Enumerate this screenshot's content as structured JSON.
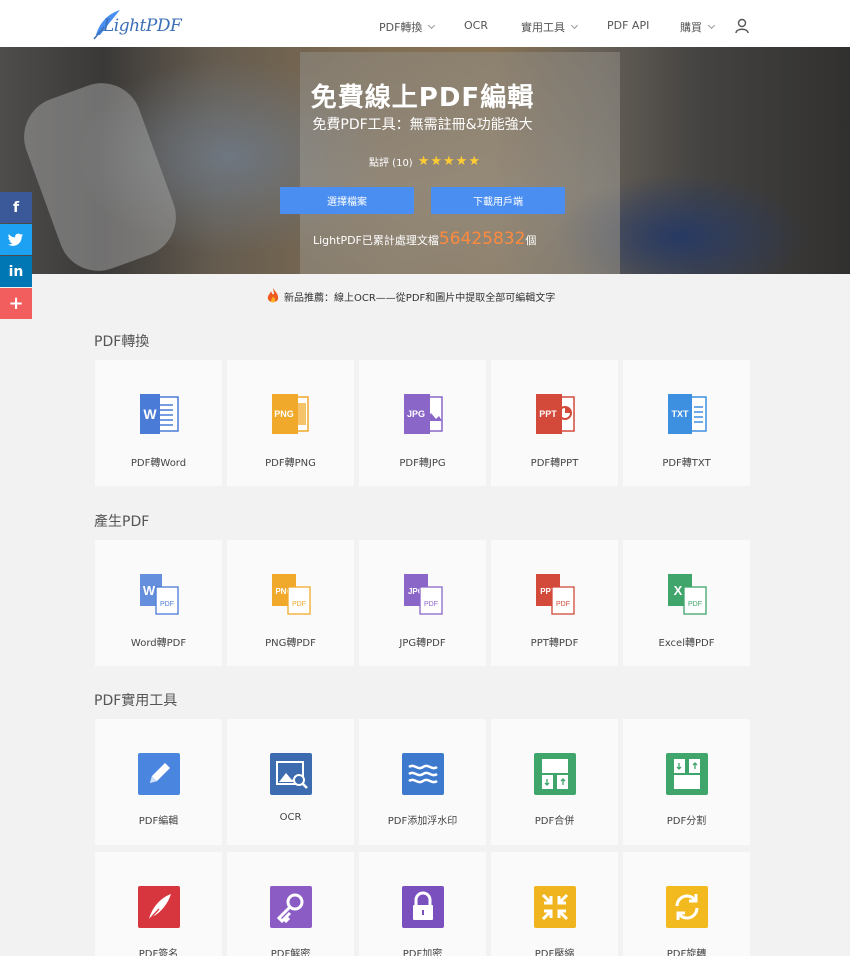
{
  "header": {
    "logo_text": "LightPDF",
    "nav": [
      {
        "label": "PDF轉換",
        "dropdown": true
      },
      {
        "label": "OCR",
        "dropdown": false
      },
      {
        "label": "實用工具",
        "dropdown": true
      },
      {
        "label": "PDF API",
        "dropdown": false
      },
      {
        "label": "購買",
        "dropdown": true
      }
    ]
  },
  "hero": {
    "title": "免費線上PDF編輯",
    "subtitle": "免費PDF工具：無需註冊&功能強大",
    "rating_label": "點評 (10)",
    "stars": "★★★★★",
    "btn_select": "選擇檔案",
    "btn_download": "下載用戶端",
    "count_prefix": "LightPDF已累計處理文檔",
    "count_value": "56425832",
    "count_suffix": "個"
  },
  "social": [
    {
      "name": "facebook",
      "glyph": "f",
      "color": "#3b5998"
    },
    {
      "name": "twitter",
      "glyph": "t",
      "color": "#1da1f2"
    },
    {
      "name": "linkedin",
      "glyph": "in",
      "color": "#0077b5"
    },
    {
      "name": "more",
      "glyph": "+",
      "color": "#f25d5d"
    }
  ],
  "news": "新品推薦：線上OCR——從PDF和圖片中提取全部可編輯文字",
  "sections": {
    "convert_title": "PDF轉換",
    "create_title": "產生PDF",
    "tools_title": "PDF實用工具"
  },
  "convert": [
    "PDF轉Word",
    "PDF轉PNG",
    "PDF轉JPG",
    "PDF轉PPT",
    "PDF轉TXT"
  ],
  "create": [
    "Word轉PDF",
    "PNG轉PDF",
    "JPG轉PDF",
    "PPT轉PDF",
    "Excel轉PDF"
  ],
  "tools": [
    "PDF編輯",
    "OCR",
    "PDF添加浮水印",
    "PDF合併",
    "PDF分割"
  ],
  "tools2": [
    "PDF簽名",
    "PDF解密",
    "PDF加密",
    "PDF壓縮",
    "PDF旋轉"
  ],
  "colors": {
    "word": "#4a7bd6",
    "png": "#f0a92a",
    "jpg": "#8a66c8",
    "ppt": "#d34a3a",
    "txt": "#3d8fe0",
    "excel": "#3fa56b",
    "edit": "#4a86e0",
    "ocr": "#3d6bb0",
    "watermark": "#3d79cc",
    "merge": "#3fa56b",
    "split": "#3fa56b",
    "sign": "#d8363f",
    "decrypt": "#8a5cc4",
    "encrypt": "#7a4fbe",
    "compress": "#f0b41e",
    "rotate": "#f2ba1e"
  }
}
